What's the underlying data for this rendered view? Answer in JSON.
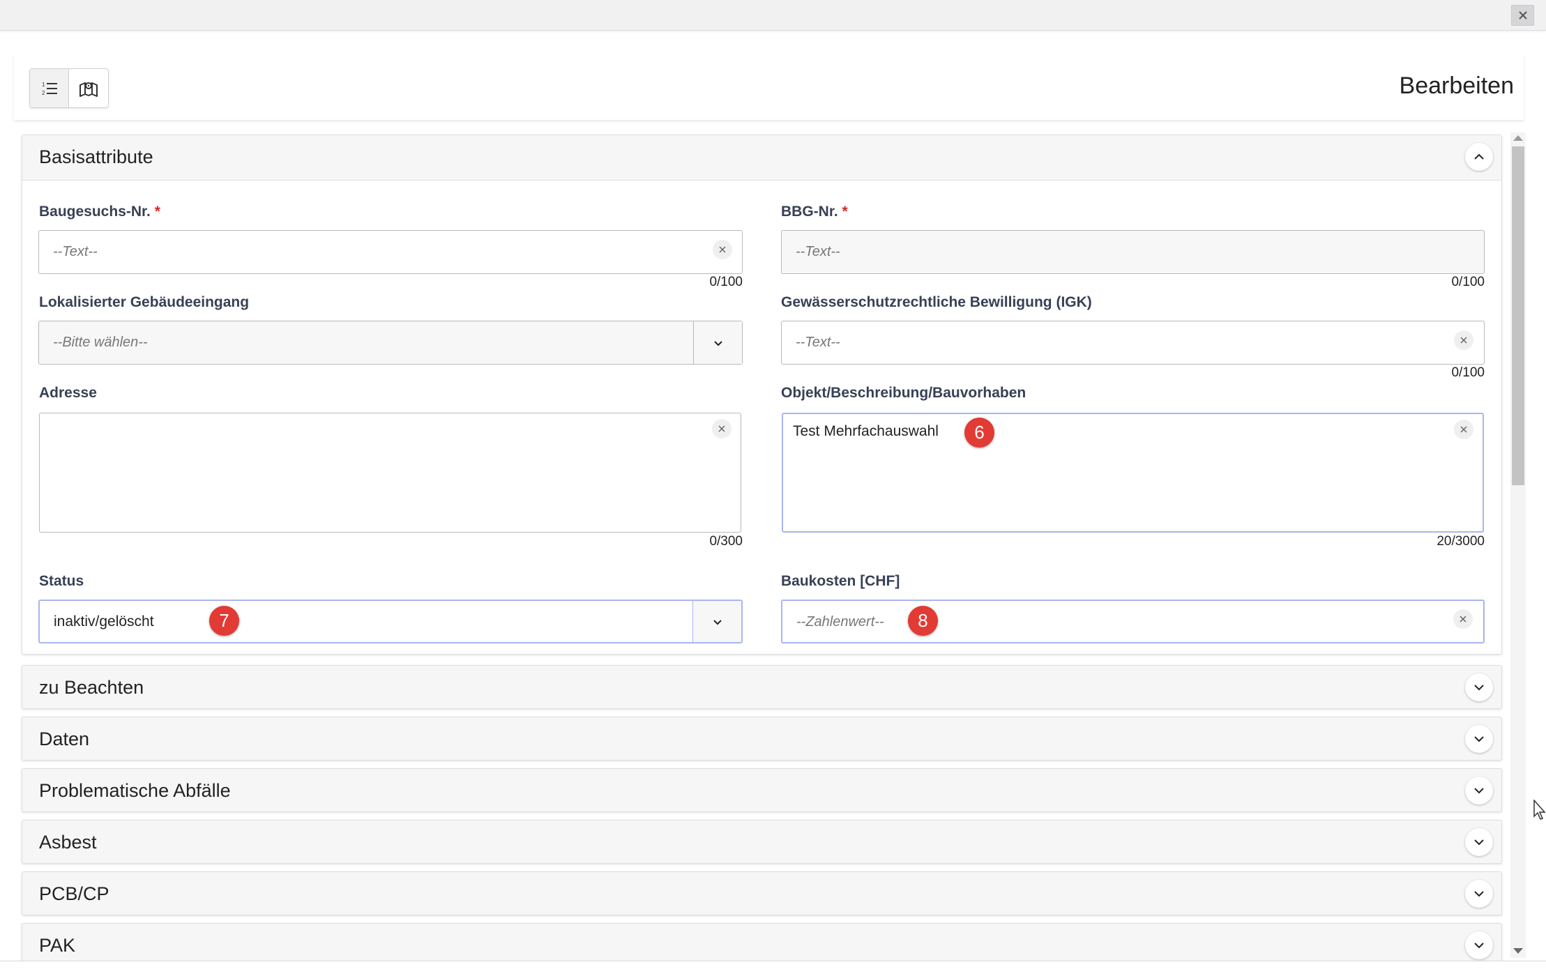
{
  "toolbar": {
    "title": "Bearbeiten",
    "buttons": [
      {
        "icon": "numbered-list-icon"
      },
      {
        "icon": "map-icon"
      }
    ]
  },
  "window": {
    "close_icon": "close-icon"
  },
  "panel": {
    "title": "Basisattribute",
    "fields": {
      "baugesuchs": {
        "label": "Baugesuchs-Nr.",
        "required_mark": "*",
        "placeholder": "--Text--",
        "counter": "0/100"
      },
      "bbg": {
        "label": "BBG-Nr.",
        "required_mark": "*",
        "placeholder": "--Text--",
        "counter": "0/100"
      },
      "gebaeudeeingang": {
        "label": "Lokalisierter Gebäudeeingang",
        "placeholder": "--Bitte wählen--"
      },
      "igk": {
        "label": "Gewässerschutzrechtliche Bewilligung (IGK)",
        "placeholder": "--Text--",
        "counter": "0/100"
      },
      "adresse": {
        "label": "Adresse",
        "value": "",
        "counter": "0/300"
      },
      "objekt": {
        "label": "Objekt/Beschreibung/Bauvorhaben",
        "value": "Test Mehrfachauswahl",
        "counter": "20/3000"
      },
      "status": {
        "label": "Status",
        "value": "inaktiv/gelöscht"
      },
      "baukosten": {
        "label": "Baukosten [CHF]",
        "placeholder": "--Zahlenwert--"
      }
    },
    "badges": {
      "objekt": "6",
      "status": "7",
      "baukosten": "8"
    }
  },
  "sections": [
    {
      "title": "zu Beachten"
    },
    {
      "title": "Daten"
    },
    {
      "title": "Problematische Abfälle"
    },
    {
      "title": "Asbest"
    },
    {
      "title": "PCB/CP"
    },
    {
      "title": "PAK"
    }
  ],
  "colors": {
    "badge": "#e23a34",
    "focus_border": "#a9b5f0",
    "label": "#374155",
    "required": "#e02424"
  }
}
